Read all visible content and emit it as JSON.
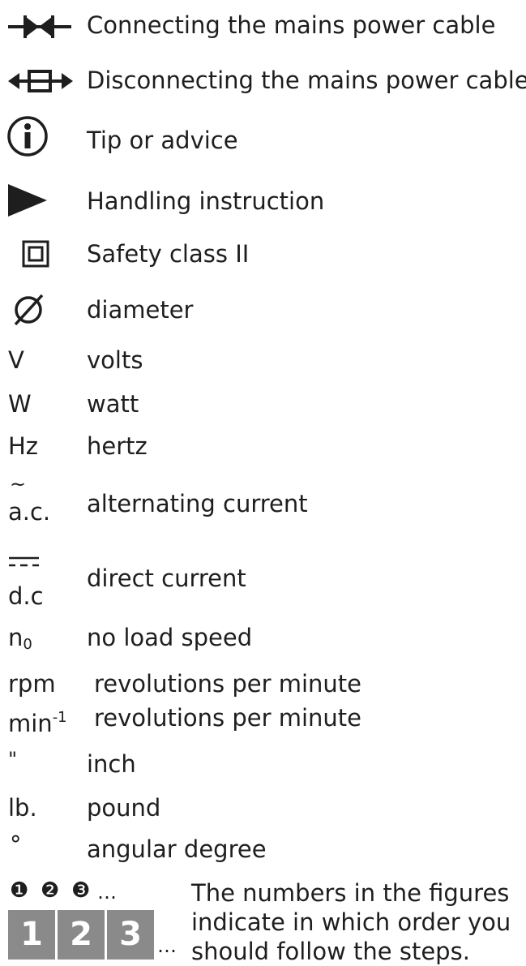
{
  "legend": [
    {
      "icon": "plug-connect-icon",
      "label": "Connecting the mains power cable"
    },
    {
      "icon": "plug-disconnect-icon",
      "label": "Disconnecting the mains power cable"
    },
    {
      "icon": "info-icon",
      "label": "Tip or advice"
    },
    {
      "icon": "play-triangle-icon",
      "label": "Handling instruction"
    },
    {
      "icon": "double-square-icon",
      "label": "Safety class II"
    },
    {
      "icon": "diameter-icon",
      "label": "diameter"
    },
    {
      "symbol": "V",
      "label": "volts"
    },
    {
      "symbol": "W",
      "label": "watt"
    },
    {
      "symbol": "Hz",
      "label": "hertz"
    },
    {
      "symbol_top": "~",
      "symbol": "a.c.",
      "label": "alternating current"
    },
    {
      "symbol": "d.c",
      "label": "direct current"
    },
    {
      "symbol": "n",
      "symbol_sub": "0",
      "label": "no load speed"
    },
    {
      "symbol": "rpm",
      "label": "revolutions per minute"
    },
    {
      "symbol": "min",
      "symbol_sup": "-1",
      "label": "revolutions per minute"
    },
    {
      "symbol": "\"",
      "label": "inch"
    },
    {
      "symbol": "lb.",
      "label": "pound"
    },
    {
      "symbol": "°",
      "label": "angular degree"
    }
  ],
  "steps": {
    "circled": [
      "❶",
      "❷",
      "❸"
    ],
    "circled_ellipsis": "…",
    "tiles": [
      "1",
      "2",
      "3"
    ],
    "tiles_ellipsis": "…",
    "text_lines": [
      "The numbers in the figures",
      "indicate in which order you",
      "should follow the steps."
    ]
  }
}
